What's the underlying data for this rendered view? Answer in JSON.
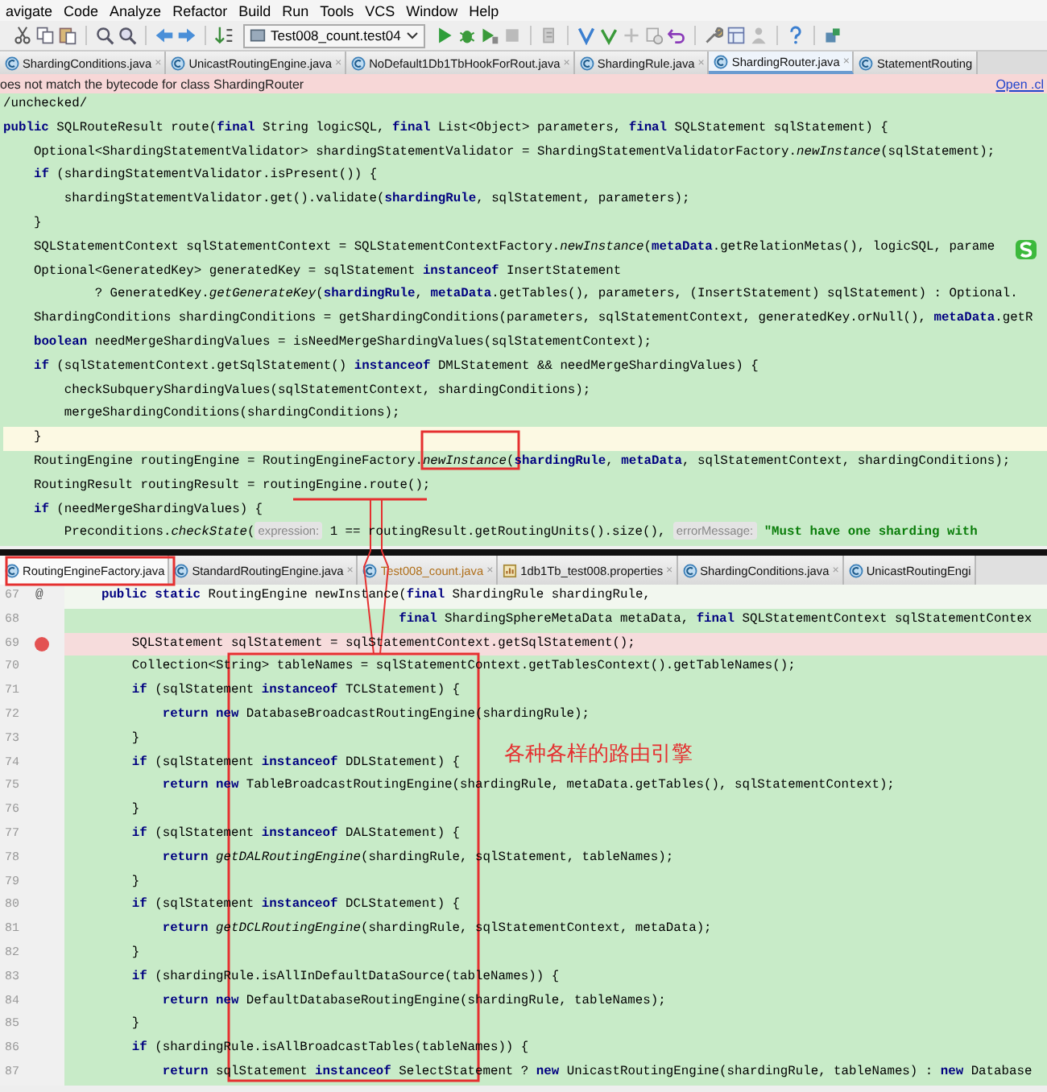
{
  "menu": [
    "avigate",
    "Code",
    "Analyze",
    "Refactor",
    "Build",
    "Run",
    "Tools",
    "VCS",
    "Window",
    "Help"
  ],
  "toolbar": {
    "run_config": "Test008_count.test04"
  },
  "editor_tabs": [
    {
      "label": "ShardingConditions.java",
      "kind": "class",
      "selected": false,
      "close": "×"
    },
    {
      "label": "UnicastRoutingEngine.java",
      "kind": "class",
      "selected": false,
      "close": "×"
    },
    {
      "label": "NoDefault1Db1TbHookForRout.java",
      "kind": "class",
      "selected": false,
      "close": "×"
    },
    {
      "label": "ShardingRule.java",
      "kind": "class",
      "selected": false,
      "close": "×"
    },
    {
      "label": "ShardingRouter.java",
      "kind": "class",
      "selected": true,
      "close": "×"
    },
    {
      "label": "StatementRouting",
      "kind": "class",
      "selected": false
    }
  ],
  "banner": {
    "message": "oes not match the bytecode for class ShardingRouter",
    "link": "Open .cl"
  },
  "code": [
    {
      "text": "/unchecked/",
      "current": false
    },
    {
      "text": "**public** SQLRouteResult route(**final** String logicSQL, **final** List<Object> parameters, **final** SQLStatement sqlStatement) {",
      "current": false
    },
    {
      "text": "    Optional<ShardingStatementValidator> shardingStatementValidator = ShardingStatementValidatorFactory.*newInstance*(sqlStatement);",
      "current": false
    },
    {
      "text": "    **if** (shardingStatementValidator.isPresent()) {",
      "current": false
    },
    {
      "text": "        shardingStatementValidator.get().validate(**shardingRule**, sqlStatement, parameters);",
      "current": false
    },
    {
      "text": "    }",
      "current": false
    },
    {
      "text": "    SQLStatementContext sqlStatementContext = SQLStatementContextFactory.*newInstance*(**metaData**.getRelationMetas(), logicSQL, parame",
      "current": false
    },
    {
      "text": "    Optional<GeneratedKey> generatedKey = sqlStatement **instanceof** InsertStatement",
      "current": false
    },
    {
      "text": "            ? GeneratedKey.*getGenerateKey*(**shardingRule**, **metaData**.getTables(), parameters, (InsertStatement) sqlStatement) : Optional.",
      "current": false
    },
    {
      "text": "    ShardingConditions shardingConditions = getShardingConditions(parameters, sqlStatementContext, generatedKey.orNull(), **metaData**.getR",
      "current": false
    },
    {
      "text": "    **boolean** needMergeShardingValues = isNeedMergeShardingValues(sqlStatementContext);",
      "current": false
    },
    {
      "text": "    **if** (sqlStatementContext.getSqlStatement() **instanceof** DMLStatement && needMergeShardingValues) {",
      "current": false
    },
    {
      "text": "        checkSubqueryShardingValues(sqlStatementContext, shardingConditions);",
      "current": false
    },
    {
      "text": "        mergeShardingConditions(shardingConditions);",
      "current": false
    },
    {
      "text": "    }",
      "current": true
    },
    {
      "text": "    RoutingEngine routingEngine = RoutingEngineFactory.*newInstance*(**shardingRule**, **metaData**, sqlStatementContext, shardingConditions);",
      "current": false
    },
    {
      "text": "    RoutingResult routingResult = routingEngine.route();",
      "current": false
    },
    {
      "text": "    **if** (needMergeShardingValues) {",
      "current": false
    },
    {
      "current": false,
      "parts": [
        {
          "kind": "code",
          "text": "        Preconditions.*checkState*("
        },
        {
          "kind": "hint",
          "text": "expression:"
        },
        {
          "kind": "code",
          "text": " 1 == routingResult.getRoutingUnits().size(), "
        },
        {
          "kind": "hint",
          "text": "errorMessage:"
        },
        {
          "kind": "string",
          "text": " \"Must have one sharding with"
        }
      ]
    }
  ],
  "bottom_tabs": [
    {
      "label": "RoutingEngineFactory.java",
      "kind": "class",
      "selected": true,
      "modified": false
    },
    {
      "label": "StandardRoutingEngine.java",
      "kind": "class",
      "selected": false,
      "modified": false,
      "close": "×"
    },
    {
      "label": "Test008_count.java",
      "kind": "class",
      "selected": false,
      "modified": true,
      "close": "×"
    },
    {
      "label": "1db1Tb_test008.properties",
      "kind": "properties",
      "selected": false,
      "modified": false,
      "close": "×"
    },
    {
      "label": "ShardingConditions.java",
      "kind": "class",
      "selected": false,
      "modified": false,
      "close": "×"
    },
    {
      "label": "UnicastRoutingEngi",
      "kind": "class",
      "selected": false,
      "modified": false
    }
  ],
  "bottom_code": [
    {
      "number": "67",
      "gutter": "@",
      "breakpoint": false,
      "current": true,
      "text": "    **public static** RoutingEngine newInstance(**final** ShardingRule shardingRule,"
    },
    {
      "number": "68",
      "breakpoint": false,
      "current": false,
      "text": "                                           **final** ShardingSphereMetaData metaData, **final** SQLStatementContext sqlStatementContex"
    },
    {
      "number": "69",
      "breakpoint": true,
      "current": false,
      "text": "        SQLStatement sqlStatement = sqlStatementContext.getSqlStatement();"
    },
    {
      "number": "70",
      "breakpoint": false,
      "current": false,
      "text": "        Collection<String> tableNames = sqlStatementContext.getTablesContext().getTableNames();"
    },
    {
      "number": "71",
      "breakpoint": false,
      "current": false,
      "text": "        **if** (sqlStatement **instanceof** TCLStatement) {"
    },
    {
      "number": "72",
      "breakpoint": false,
      "current": false,
      "text": "            **return new** DatabaseBroadcastRoutingEngine(shardingRule);"
    },
    {
      "number": "73",
      "breakpoint": false,
      "current": false,
      "text": "        }"
    },
    {
      "number": "74",
      "breakpoint": false,
      "current": false,
      "text": "        **if** (sqlStatement **instanceof** DDLStatement) {"
    },
    {
      "number": "75",
      "breakpoint": false,
      "current": false,
      "text": "            **return new** TableBroadcastRoutingEngine(shardingRule, metaData.getTables(), sqlStatementContext);"
    },
    {
      "number": "76",
      "breakpoint": false,
      "current": false,
      "text": "        }"
    },
    {
      "number": "77",
      "breakpoint": false,
      "current": false,
      "text": "        **if** (sqlStatement **instanceof** DALStatement) {"
    },
    {
      "number": "78",
      "breakpoint": false,
      "current": false,
      "text": "            **return** *getDALRoutingEngine*(shardingRule, sqlStatement, tableNames);"
    },
    {
      "number": "79",
      "breakpoint": false,
      "current": false,
      "text": "        }"
    },
    {
      "number": "80",
      "breakpoint": false,
      "current": false,
      "text": "        **if** (sqlStatement **instanceof** DCLStatement) {"
    },
    {
      "number": "81",
      "breakpoint": false,
      "current": false,
      "text": "            **return** *getDCLRoutingEngine*(shardingRule, sqlStatementContext, metaData);"
    },
    {
      "number": "82",
      "breakpoint": false,
      "current": false,
      "text": "        }"
    },
    {
      "number": "83",
      "breakpoint": false,
      "current": false,
      "text": "        **if** (shardingRule.isAllInDefaultDataSource(tableNames)) {"
    },
    {
      "number": "84",
      "breakpoint": false,
      "current": false,
      "text": "            **return new** DefaultDatabaseRoutingEngine(shardingRule, tableNames);"
    },
    {
      "number": "85",
      "breakpoint": false,
      "current": false,
      "text": "        }"
    },
    {
      "number": "86",
      "breakpoint": false,
      "current": false,
      "text": "        **if** (shardingRule.isAllBroadcastTables(tableNames)) {"
    },
    {
      "number": "87",
      "breakpoint": false,
      "current": false,
      "text": "            **return** sqlStatement **instanceof** SelectStatement ? **new** UnicastRoutingEngine(shardingRule, tableNames) : **new** Database"
    }
  ],
  "annotation": "各种各样的路由引擎"
}
